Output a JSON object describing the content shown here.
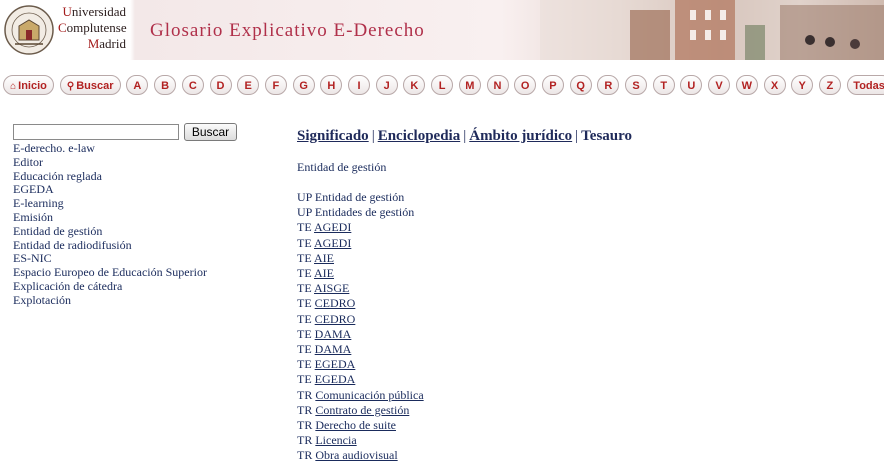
{
  "header": {
    "university_lines": [
      "Universidad",
      "Complutense",
      "Madrid"
    ],
    "site_title": "Glosario Explicativo E-Derecho"
  },
  "nav": {
    "home_label": "Inicio",
    "search_label": "Buscar",
    "letters": [
      "A",
      "B",
      "C",
      "D",
      "E",
      "F",
      "G",
      "H",
      "I",
      "J",
      "K",
      "L",
      "M",
      "N",
      "O",
      "P",
      "Q",
      "R",
      "S",
      "T",
      "U",
      "V",
      "W",
      "X",
      "Y",
      "Z"
    ],
    "all_label": "Todas"
  },
  "search": {
    "value": "",
    "button_label": "Buscar"
  },
  "terms": [
    "E-derecho. e-law",
    "Editor",
    "Educación reglada",
    "EGEDA",
    "E-learning",
    "Emisión",
    "Entidad de gestión",
    "Entidad de radiodifusión",
    "ES-NIC",
    "Espacio Europeo de Educación Superior",
    "Explicación de cátedra",
    "Explotación"
  ],
  "tabs": {
    "significado": "Significado",
    "enciclopedia": "Enciclopedia",
    "ambito": "Ámbito jurídico",
    "tesauro": "Tesauro",
    "separator": "|"
  },
  "entity": "Entidad de gestión",
  "relations": [
    {
      "prefix": "UP",
      "text": "Entidad de gestión",
      "link": false
    },
    {
      "prefix": "UP",
      "text": "Entidades de gestión",
      "link": false
    },
    {
      "prefix": "TE",
      "text": "AGEDI",
      "link": true
    },
    {
      "prefix": "TE",
      "text": "AGEDI",
      "link": true
    },
    {
      "prefix": "TE",
      "text": "AIE",
      "link": true
    },
    {
      "prefix": "TE",
      "text": "AIE",
      "link": true
    },
    {
      "prefix": "TE",
      "text": "AISGE",
      "link": true
    },
    {
      "prefix": "TE",
      "text": "CEDRO",
      "link": true
    },
    {
      "prefix": "TE",
      "text": "CEDRO",
      "link": true
    },
    {
      "prefix": "TE",
      "text": "DAMA",
      "link": true
    },
    {
      "prefix": "TE",
      "text": "DAMA",
      "link": true
    },
    {
      "prefix": "TE",
      "text": "EGEDA",
      "link": true
    },
    {
      "prefix": "TE",
      "text": "EGEDA",
      "link": true
    },
    {
      "prefix": "TR",
      "text": "Comunicación pública",
      "link": true
    },
    {
      "prefix": "TR",
      "text": "Contrato de gestión",
      "link": true
    },
    {
      "prefix": "TR",
      "text": "Derecho de suite",
      "link": true
    },
    {
      "prefix": "TR",
      "text": "Licencia",
      "link": true
    },
    {
      "prefix": "TR",
      "text": "Obra audiovisual",
      "link": true
    }
  ],
  "colors": {
    "nav_text": "#b22222",
    "link_text": "#1a2b5c",
    "title_text": "#b0304a"
  },
  "icons": {
    "home": "home-icon",
    "search": "magnifier-icon",
    "crest": "university-crest-icon"
  }
}
